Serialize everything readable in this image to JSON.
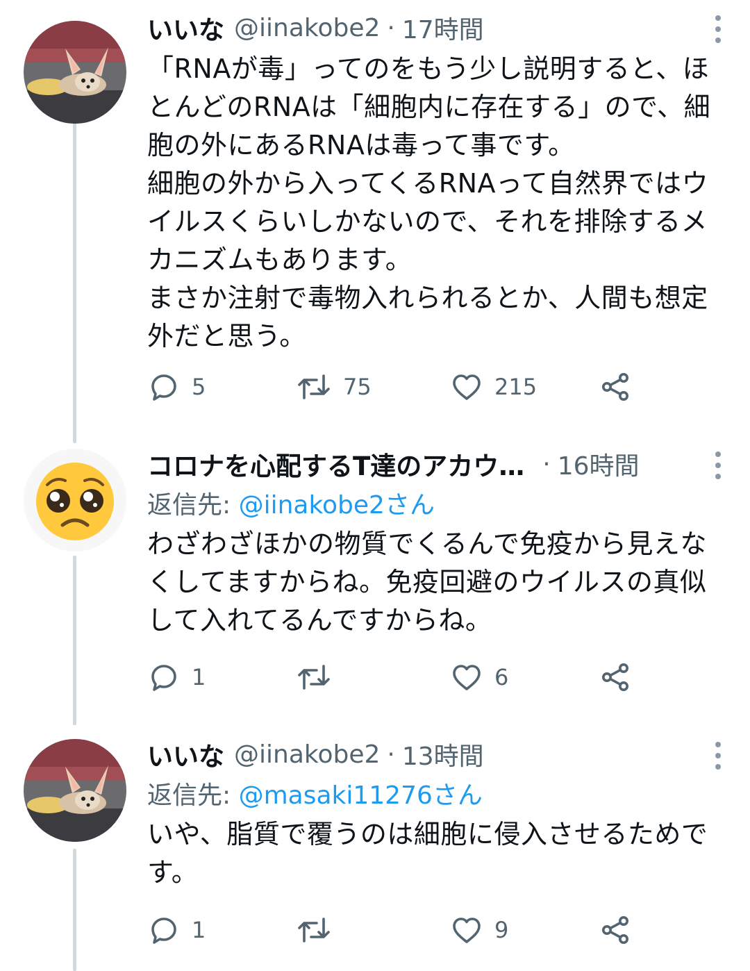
{
  "tweets": [
    {
      "name": "いいな",
      "handle": "@iinakobe2",
      "dot": "·",
      "time": "17時間",
      "avatar_icon": "fennec-fox-avatar",
      "body": "「RNAが毒」ってのをもう少し説明すると、ほとんどのRNAは「細胞内に存在する」ので、細胞の外にあるRNAは毒って事です。\n細胞の外から入ってくるRNAって自然界ではウイルスくらいしかないので、それを排除するメカニズムもあります。\nまさか注射で毒物入れられるとか、人間も想定外だと思う。",
      "replies": "5",
      "retweets": "75",
      "likes": "215"
    },
    {
      "name": "コロナを心配するT達のアカウ…",
      "dot": "·",
      "time": "16時間",
      "avatar_icon": "pleading-face-emoji-avatar",
      "reply_prefix": "返信先: ",
      "reply_target": "@iinakobe2さん",
      "body": "わざわざほかの物質でくるんで免疫から見えなくしてますからね。免疫回避のウイルスの真似して入れてるんですからね。",
      "replies": "1",
      "retweets": "",
      "likes": "6"
    },
    {
      "name": "いいな",
      "handle": "@iinakobe2",
      "dot": "·",
      "time": "13時間",
      "avatar_icon": "fennec-fox-avatar",
      "reply_prefix": "返信先: ",
      "reply_target": "@masaki11276さん",
      "body": "いや、脂質で覆うのは細胞に侵入させるためです。",
      "replies": "1",
      "retweets": "",
      "likes": "9"
    }
  ],
  "colors": {
    "text": "#0f1419",
    "secondary": "#536471",
    "link": "#1d9bf0",
    "thread_line": "#cfd9de"
  },
  "icons": [
    "reply-icon",
    "retweet-icon",
    "like-icon",
    "share-icon",
    "more-icon"
  ]
}
